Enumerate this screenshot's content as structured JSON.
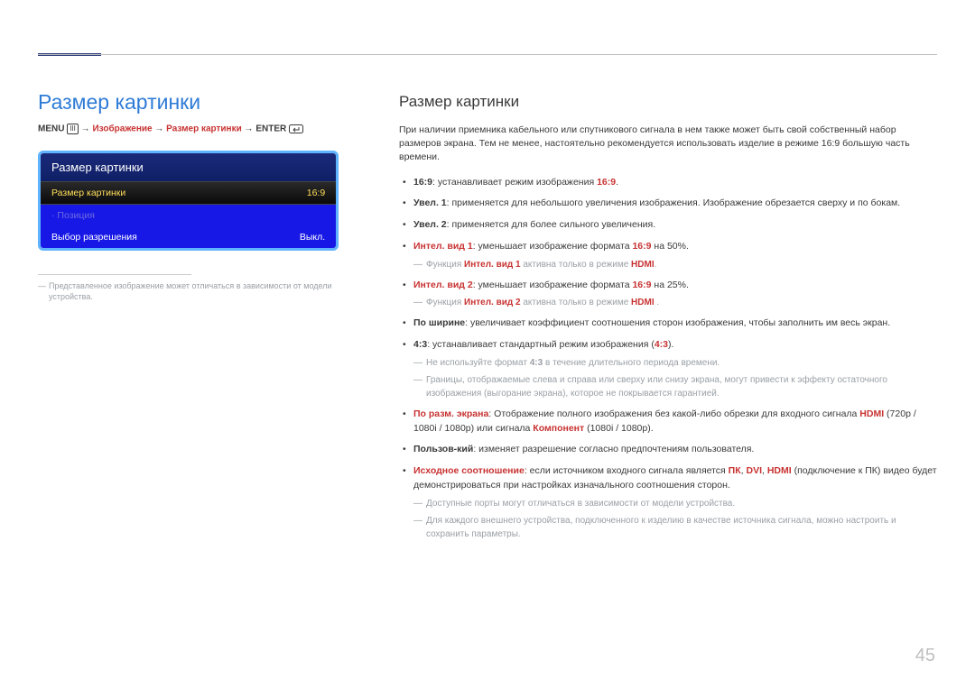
{
  "page_number": "45",
  "left": {
    "title": "Размер картинки",
    "path": {
      "menu": "MENU",
      "menu_icon": "III",
      "step1": "Изображение",
      "step2": "Размер картинки",
      "enter": "ENTER"
    },
    "osd": {
      "header": "Размер картинки",
      "rows": [
        {
          "label": "Размер картинки",
          "value": "16:9",
          "kind": "selected"
        },
        {
          "label": "Позиция",
          "value": "",
          "kind": "dim"
        },
        {
          "label": "Выбор разрешения",
          "value": "Выкл.",
          "kind": "normal"
        }
      ]
    },
    "note": "Представленное изображение может отличаться в зависимости от модели устройства."
  },
  "right": {
    "title": "Размер картинки",
    "intro": "При наличии приемника кабельного или спутникового сигнала в нем также может быть свой собственный набор размеров экрана. Тем не менее, настоятельно рекомендуется использовать изделие в режиме 16:9 большую часть времени.",
    "items": [
      {
        "segments": [
          {
            "t": "16:9",
            "c": "b"
          },
          {
            "t": ": устанавливает режим изображения ",
            "c": ""
          },
          {
            "t": "16:9",
            "c": "r"
          },
          {
            "t": ".",
            "c": ""
          }
        ]
      },
      {
        "segments": [
          {
            "t": "Увел. 1",
            "c": "b"
          },
          {
            "t": ": применяется для небольшого увеличения изображения. Изображение обрезается сверху и по бокам.",
            "c": ""
          }
        ]
      },
      {
        "segments": [
          {
            "t": "Увел. 2",
            "c": "b"
          },
          {
            "t": ": применяется для более сильного увеличения.",
            "c": ""
          }
        ]
      },
      {
        "segments": [
          {
            "t": "Интел. вид 1",
            "c": "r"
          },
          {
            "t": ": уменьшает изображение формата ",
            "c": ""
          },
          {
            "t": "16:9",
            "c": "r"
          },
          {
            "t": " на 50%.",
            "c": ""
          }
        ],
        "subs": [
          [
            {
              "t": "Функция ",
              "c": ""
            },
            {
              "t": "Интел. вид 1",
              "c": "r"
            },
            {
              "t": " активна только в режиме ",
              "c": ""
            },
            {
              "t": "HDMI",
              "c": "r"
            },
            {
              "t": ".",
              "c": ""
            }
          ]
        ]
      },
      {
        "segments": [
          {
            "t": "Интел. вид 2",
            "c": "r"
          },
          {
            "t": ": уменьшает изображение формата ",
            "c": ""
          },
          {
            "t": "16:9",
            "c": "r"
          },
          {
            "t": " на 25%.",
            "c": ""
          }
        ],
        "subs": [
          [
            {
              "t": "Функция ",
              "c": ""
            },
            {
              "t": "Интел. вид 2",
              "c": "r"
            },
            {
              "t": " активна только в режиме ",
              "c": ""
            },
            {
              "t": "HDMI",
              "c": "r"
            },
            {
              "t": " .",
              "c": ""
            }
          ]
        ]
      },
      {
        "segments": [
          {
            "t": "По ширине",
            "c": "b"
          },
          {
            "t": ": увеличивает коэффициент соотношения сторон изображения, чтобы заполнить им весь экран.",
            "c": ""
          }
        ]
      },
      {
        "segments": [
          {
            "t": "4:3",
            "c": "b"
          },
          {
            "t": ": устанавливает стандартный режим изображения (",
            "c": ""
          },
          {
            "t": "4:3",
            "c": "r"
          },
          {
            "t": ").",
            "c": ""
          }
        ],
        "subs": [
          [
            {
              "t": "Не используйте формат ",
              "c": ""
            },
            {
              "t": "4:3",
              "c": "b"
            },
            {
              "t": " в течение длительного периода времени.",
              "c": ""
            }
          ],
          [
            {
              "t": "Границы, отображаемые слева и справа или сверху или снизу экрана, могут привести к эффекту остаточного изображения (выгорание экрана), которое не покрывается гарантией.",
              "c": ""
            }
          ]
        ],
        "subs_no_dash_after_first": true
      },
      {
        "segments": [
          {
            "t": "По разм. экрана",
            "c": "r"
          },
          {
            "t": ": Отображение полного изображения без какой-либо обрезки для входного сигнала ",
            "c": ""
          },
          {
            "t": "HDMI",
            "c": "r"
          },
          {
            "t": " (720p / 1080i / 1080p) или сигнала ",
            "c": ""
          },
          {
            "t": "Компонент",
            "c": "r"
          },
          {
            "t": " (1080i / 1080p).",
            "c": ""
          }
        ]
      },
      {
        "segments": [
          {
            "t": "Пользов-кий",
            "c": "b"
          },
          {
            "t": ": изменяет разрешение согласно предпочтениям пользователя.",
            "c": ""
          }
        ]
      },
      {
        "segments": [
          {
            "t": "Исходное соотношение",
            "c": "r"
          },
          {
            "t": ": если источником входного сигнала является ",
            "c": ""
          },
          {
            "t": "ПК",
            "c": "r"
          },
          {
            "t": ", ",
            "c": ""
          },
          {
            "t": "DVI",
            "c": "r"
          },
          {
            "t": ", ",
            "c": ""
          },
          {
            "t": "HDMI",
            "c": "r"
          },
          {
            "t": " (подключение к ПК) видео будет демонстрироваться при настройках изначального соотношения сторон.",
            "c": ""
          }
        ],
        "subs": [
          [
            {
              "t": "Доступные порты могут отличаться в зависимости от модели устройства.",
              "c": ""
            }
          ],
          [
            {
              "t": "Для каждого внешнего устройства, подключенного к изделию в качестве источника сигнала, можно настроить и сохранить параметры.",
              "c": ""
            }
          ]
        ]
      }
    ]
  }
}
